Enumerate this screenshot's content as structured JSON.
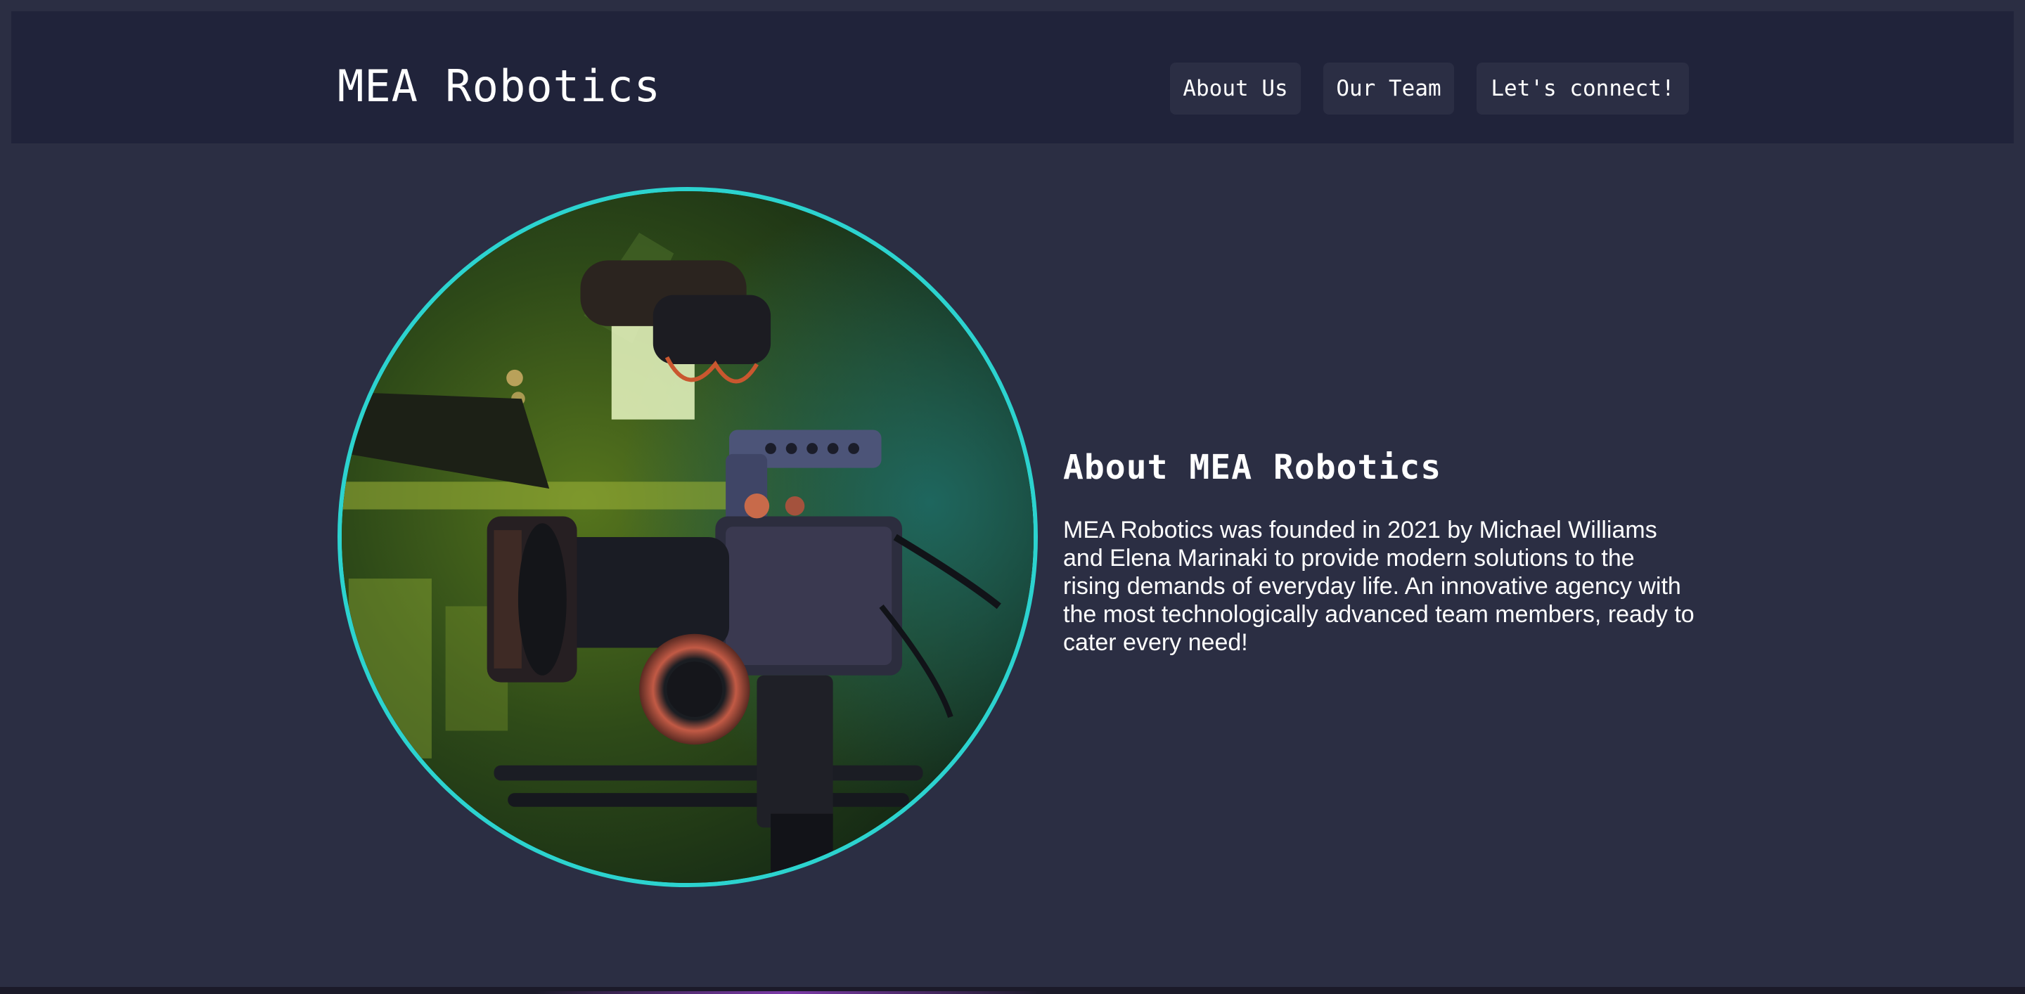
{
  "header": {
    "brand": "MEA Robotics",
    "nav": [
      {
        "label": "About Us"
      },
      {
        "label": "Our Team"
      },
      {
        "label": "Let's connect!"
      }
    ]
  },
  "about": {
    "heading": "About MEA Robotics",
    "body": "MEA Robotics was founded in 2021 by Michael Williams and Elena Marinaki to provide modern solutions to the rising demands of everyday life. An innovative agency with the most technologically advanced team members, ready to cater every need!"
  },
  "colors": {
    "page_background": "#2b2e43",
    "header_background": "#20233a",
    "photo_border": "#2cd3cf",
    "text": "#ffffff"
  }
}
